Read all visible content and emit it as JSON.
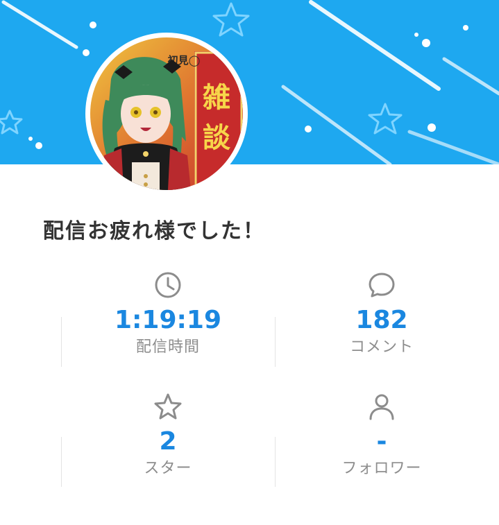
{
  "banner": {
    "color": "#1ea8f0"
  },
  "avatar": {
    "text_1": "雑",
    "text_2": "談",
    "corner_text": "初見◯"
  },
  "message": "配信お疲れ様でした！",
  "stats": [
    {
      "icon": "clock-icon",
      "value": "1:19:19",
      "label": "配信時間"
    },
    {
      "icon": "comment-icon",
      "value": "182",
      "label": "コメント"
    },
    {
      "icon": "star-icon",
      "value": "2",
      "label": "スター"
    },
    {
      "icon": "person-icon",
      "value": "-",
      "label": "フォロワー"
    }
  ],
  "colors": {
    "value": "#1a87e0",
    "label": "#8d8d8d",
    "icon": "#8c8c8c",
    "title": "#333333"
  }
}
